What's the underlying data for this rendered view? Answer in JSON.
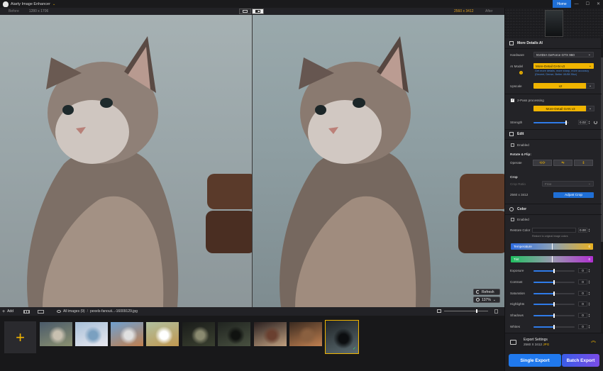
{
  "app": {
    "title": "Aiarty Image Enhancer",
    "home_label": "Home",
    "window_controls": [
      "—",
      "☐",
      "✕"
    ]
  },
  "compare": {
    "before_label": "Before",
    "before_size": "1280 x 1706",
    "after_size": "2560 x 3412",
    "after_label": "After"
  },
  "viewer": {
    "refresh_label": "Refresh",
    "zoom_label": "137%"
  },
  "bottom": {
    "add_label": "Add",
    "all_images": "All images (9)",
    "sep": "/",
    "filename": "pexels-fanouii...-16009129.jpg",
    "zoom_fraction": 0.72
  },
  "thumbnails": [
    {
      "name": "thumb-1",
      "colors": [
        "#4a5a6a",
        "#8a9070",
        "#c8c0b0"
      ]
    },
    {
      "name": "thumb-2",
      "colors": [
        "#a8c0d8",
        "#e8e8f0",
        "#7aa0c0"
      ]
    },
    {
      "name": "thumb-3",
      "colors": [
        "#6fa0d0",
        "#c08050",
        "#e0e0e0"
      ]
    },
    {
      "name": "thumb-4",
      "colors": [
        "#b0c0a0",
        "#c09850",
        "#ffffff"
      ]
    },
    {
      "name": "thumb-5",
      "colors": [
        "#1a1c1a",
        "#3a4030",
        "#8a8a70"
      ]
    },
    {
      "name": "thumb-6",
      "colors": [
        "#202420",
        "#485040",
        "#101210"
      ]
    },
    {
      "name": "thumb-7",
      "colors": [
        "#2a2020",
        "#c0a080",
        "#6a4030"
      ]
    },
    {
      "name": "thumb-8",
      "colors": [
        "#3a2a20",
        "#c08050",
        "#8a6040"
      ]
    },
    {
      "name": "thumb-9",
      "colors": [
        "#202426",
        "#5a6a70",
        "#0c0e10"
      ]
    }
  ],
  "panel": {
    "more_details": {
      "title": "More Details AI",
      "hardware_label": "Hardware",
      "hardware_value": "NVIDIA GeForce GTX 960",
      "ai_model_label": "AI Model",
      "ai_model_value": "More-Detail GAN  v3",
      "note": "Get more details, more sharp, more accuracy\n(Decent, Dense, Better 4K/8K Blur)",
      "upscale_label": "Upscale",
      "upscale_value": "x2",
      "two_pass_label": "2-Pass processing",
      "two_pass_enabled": true,
      "two_pass_model": "More-Detail GAN  v3",
      "strength_label": "Strength",
      "strength_value": "0.02",
      "strength_fraction": 0.92
    },
    "edit": {
      "title": "Edit",
      "enabled_label": "Enabled",
      "rotate_flip_label": "Rotate & Flip:",
      "operate_label": "Operate",
      "operate_glyphs": [
        "⟲⟳",
        "⇋",
        "⇕"
      ],
      "crop_label": "Crop",
      "crop_ratio_label": "Crop Ratio",
      "crop_ratio_value": "Free",
      "crop_size": "2560 x 3412",
      "adjust_crop_label": "Adjust Crop"
    },
    "color": {
      "title": "Color",
      "enabled_label": "Enabled",
      "restore_label": "Restore Color",
      "restore_value": "0.00",
      "restore_hint": "Restore to original image colors",
      "temperature_label": "Temperature",
      "temperature_value": "0",
      "tint_label": "Tint",
      "tint_value": "0",
      "sliders": [
        {
          "name": "exposure",
          "label": "Exposure",
          "value": "0"
        },
        {
          "name": "contrast",
          "label": "Contrast",
          "value": "0"
        },
        {
          "name": "saturation",
          "label": "Saturation",
          "value": "0"
        },
        {
          "name": "highlights",
          "label": "Highlights",
          "value": "0"
        },
        {
          "name": "shadows",
          "label": "Shadows",
          "value": "0"
        },
        {
          "name": "whites",
          "label": "Whites",
          "value": "0"
        }
      ]
    },
    "export": {
      "title": "Export Settings",
      "size": "2560 X 3412",
      "format": "JPG",
      "single_label": "Single Export",
      "batch_label": "Batch Export"
    }
  },
  "colors": {
    "accent_yellow": "#f0b400",
    "accent_blue": "#1f6fd6",
    "panel_bg": "#232327"
  }
}
